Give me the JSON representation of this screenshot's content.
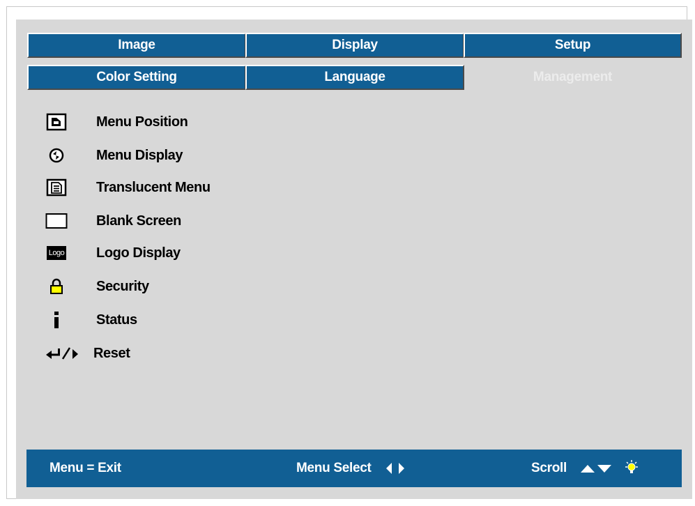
{
  "tabs_row1": [
    {
      "label": "Image"
    },
    {
      "label": "Display"
    },
    {
      "label": "Setup"
    }
  ],
  "tabs_row2": [
    {
      "label": "Color Setting"
    },
    {
      "label": "Language"
    },
    {
      "label": "Management",
      "active": true
    }
  ],
  "menu_items": [
    {
      "label": "Menu Position",
      "icon": "menu-position-icon"
    },
    {
      "label": "Menu Display",
      "icon": "menu-display-icon"
    },
    {
      "label": "Translucent Menu",
      "icon": "translucent-menu-icon"
    },
    {
      "label": "Blank Screen",
      "icon": "blank-screen-icon"
    },
    {
      "label": "Logo Display",
      "icon": "logo-icon",
      "icon_text": "Logo"
    },
    {
      "label": "Security",
      "icon": "lock-icon"
    },
    {
      "label": "Status",
      "icon": "info-icon"
    },
    {
      "label": "Reset",
      "icon": "enter-right-icon"
    }
  ],
  "bottom_bar": {
    "exit_label": "Menu = Exit",
    "select_label": "Menu Select",
    "scroll_label": "Scroll"
  },
  "colors": {
    "tab_blue": "#115f94",
    "panel_gray": "#d8d8d8",
    "lock_yellow": "#ffff00"
  }
}
